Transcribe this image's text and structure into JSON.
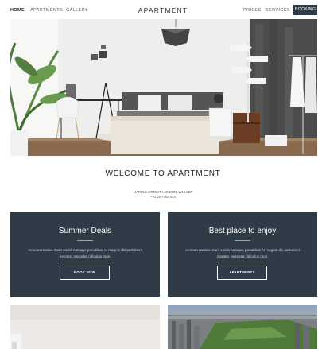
{
  "nav": {
    "home": "HOME",
    "apartments": "APARTMENTS",
    "gallery": "GALLERY",
    "brand": "APARTMENT",
    "prices": "PRICES",
    "services": "SERVICES",
    "booking": "BOOKING"
  },
  "welcome": {
    "title": "WELCOME TO APARTMENT",
    "address": "MARPLE STREET, LONDON, W15 6BP",
    "phone": "+91 20 7493 444"
  },
  "cards": [
    {
      "title": "Summer Deals",
      "text": "Aenean massa. Cum sociis natoque penatibus et magnis dis parturient montes, nascetur ridiculus mus.",
      "button": "BOOK NOW"
    },
    {
      "title": "Best place to enjoy",
      "text": "Aenean massa. Cum sociis natoque penatibus et magnis dis parturient montes, nascetur ridiculus mus.",
      "button": "APARTMENTS"
    }
  ],
  "colors": {
    "accent": "#2f3b47",
    "background": "#ffffff"
  }
}
